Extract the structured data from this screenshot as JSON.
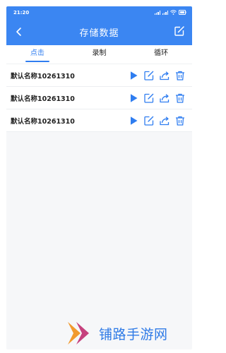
{
  "status_bar": {
    "time": "21:20"
  },
  "header": {
    "title": "存储数据",
    "bg_color": "#3b86f2"
  },
  "tabs": [
    {
      "label": "点击",
      "active": true
    },
    {
      "label": "录制",
      "active": false
    },
    {
      "label": "循环",
      "active": false
    }
  ],
  "records": [
    {
      "name": "默认名称10261310"
    },
    {
      "name": "默认名称10261310"
    },
    {
      "name": "默认名称10261310"
    }
  ],
  "row_actions": [
    "play-icon",
    "edit-icon",
    "share-icon",
    "delete-icon"
  ],
  "watermark": {
    "text": "铺路手游网"
  },
  "colors": {
    "accent": "#2f7df0",
    "brand": "#3b86f2"
  }
}
